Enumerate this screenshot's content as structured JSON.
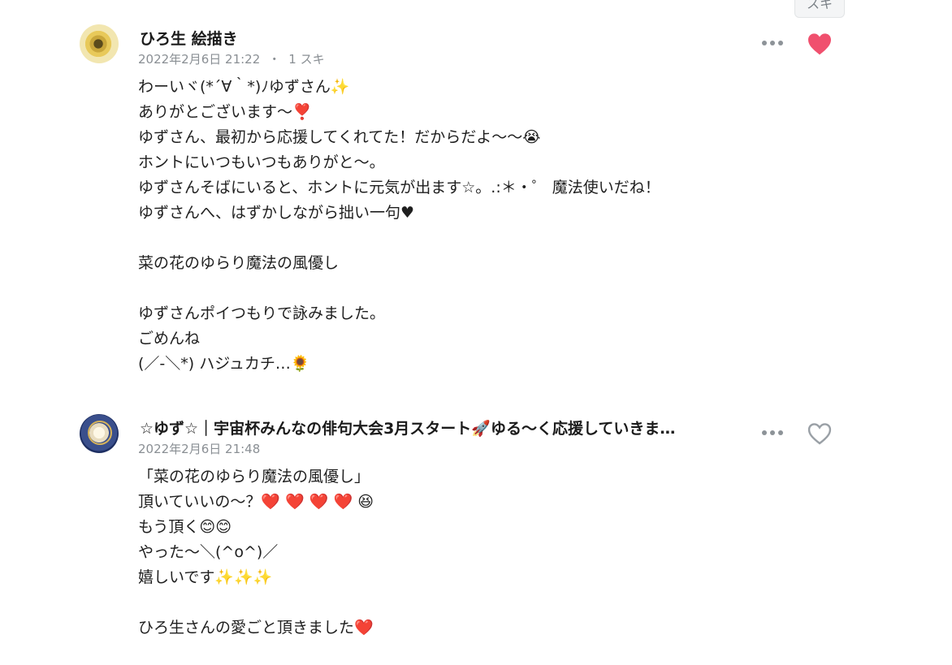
{
  "top_tag": {
    "label": "スキ"
  },
  "comments": [
    {
      "author": "ひろ生 絵描き",
      "date": "2022年2月6日 21:22",
      "separator": "・",
      "likes_text": "1 スキ",
      "liked": true,
      "avatar_icon": "sunflower-avatar",
      "lines": [
        "わーいヾ(*´∀｀*)ﾉゆずさん✨",
        "ありがとございます～❣️",
        "ゆずさん、最初から応援してくれてた！だからだよ～～😭",
        "ホントにいつもいつもありがと～。",
        "ゆずさんそばにいると、ホントに元気が出ます☆。.:＊・゜ 魔法使いだね！",
        "ゆずさんへ、はずかしながら拙い一句♥",
        "",
        "菜の花のゆらり魔法の風優し",
        "",
        "ゆずさんポイつもりで詠みました。",
        "ごめんね",
        "(／-＼*) ハジュカチ…🌻"
      ]
    },
    {
      "author": "☆ゆず☆｜宇宙杯みんなの俳句大会3月スタート🚀ゆる～く応援していきま…",
      "date": "2022年2月6日 21:48",
      "liked": false,
      "avatar_icon": "moon-avatar",
      "lines": [
        "「菜の花のゆらり魔法の風優し」",
        "頂いていいの～？❤️ ❤️ ❤️ ❤️ 😆",
        "もう頂く😊😊",
        "やった～＼(^o^)／",
        "嬉しいです✨✨✨",
        "",
        "ひろ生さんの愛ごと頂きました❤️"
      ]
    }
  ],
  "icons": {
    "more": "more-dots-icon",
    "like_filled": "heart-filled-icon",
    "like_outline": "heart-outline-icon"
  },
  "colors": {
    "heart_filled": "#f0506e",
    "heart_outline": "#9aa0a6",
    "meta_text": "#8a8f94"
  }
}
